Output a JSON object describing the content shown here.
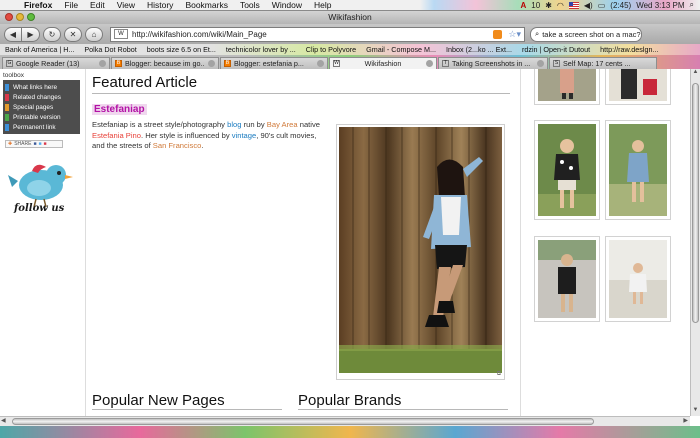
{
  "menubar": {
    "app_name": "Firefox",
    "menus": [
      "File",
      "Edit",
      "View",
      "History",
      "Bookmarks",
      "Tools",
      "Window",
      "Help"
    ],
    "battery": "10",
    "battery_time": "(2:45)",
    "clock": "Wed 3:13 PM"
  },
  "window": {
    "title": "Wikifashion"
  },
  "toolbar": {
    "back_label": "◀",
    "forward_label": "▶",
    "stop_label": "✕",
    "home_label": "⌂",
    "url": "http://wikifashion.com/wiki/Main_Page",
    "favicon_text": "W",
    "search_value": "take a screen shot on a mac?"
  },
  "bookmarks": [
    "Bank of America | H...",
    "Polka Dot Robot",
    "boots size 6.5 on Et...",
    "technicolor lover by ...",
    "Clip to Polyvore",
    "Gmail - Compose M...",
    "Inbox (2...ko ... Ext...",
    "rdzin | Open-it Dutout",
    "http://raw.deslgn..."
  ],
  "tabs": [
    {
      "label": "Google Reader (13)",
      "icon": "G",
      "active": false
    },
    {
      "label": "Blogger: because im go...",
      "icon": "B",
      "active": false
    },
    {
      "label": "Blogger: estefania p...",
      "icon": "B",
      "active": false
    },
    {
      "label": "Wikifashion",
      "icon": "W",
      "active": true
    },
    {
      "label": "Taking Screenshots in ...",
      "icon": "T",
      "active": false
    },
    {
      "label": "Self Map: 17 cents ...",
      "icon": "S",
      "active": false
    }
  ],
  "sidebar": {
    "toolbox_title": "toolbox",
    "items": [
      {
        "label": "What links here",
        "color": "#3c8fd8"
      },
      {
        "label": "Related changes",
        "color": "#d9384b"
      },
      {
        "label": "Special pages",
        "color": "#e39a2b"
      },
      {
        "label": "Printable version",
        "color": "#4aa64a"
      },
      {
        "label": "Permanent link",
        "color": "#3c8fd8"
      }
    ],
    "share_label": "SHARE",
    "follow_label": "follow us"
  },
  "main": {
    "featured_heading": "Featured Article",
    "article_title": "Estefaniap",
    "article_text": {
      "t1": "Estefaniap is a street style/photography ",
      "l1": "blog",
      "t2": " run by ",
      "l2": "Bay Area",
      "t3": " native ",
      "l3": "Estefania Pino",
      "t4": ". Her style is influenced by ",
      "l4": "vintage",
      "t5": ", 90's cult movies, and the streets of ",
      "l5": "San Francisco",
      "t6": "."
    },
    "popular_new_heading": "Popular New Pages",
    "popular_brands_heading": "Popular Brands"
  },
  "colors": {
    "link": "#1a7bc0",
    "highlight_title": "#b312a6",
    "toolbox_bg": "#4d4d4d"
  }
}
